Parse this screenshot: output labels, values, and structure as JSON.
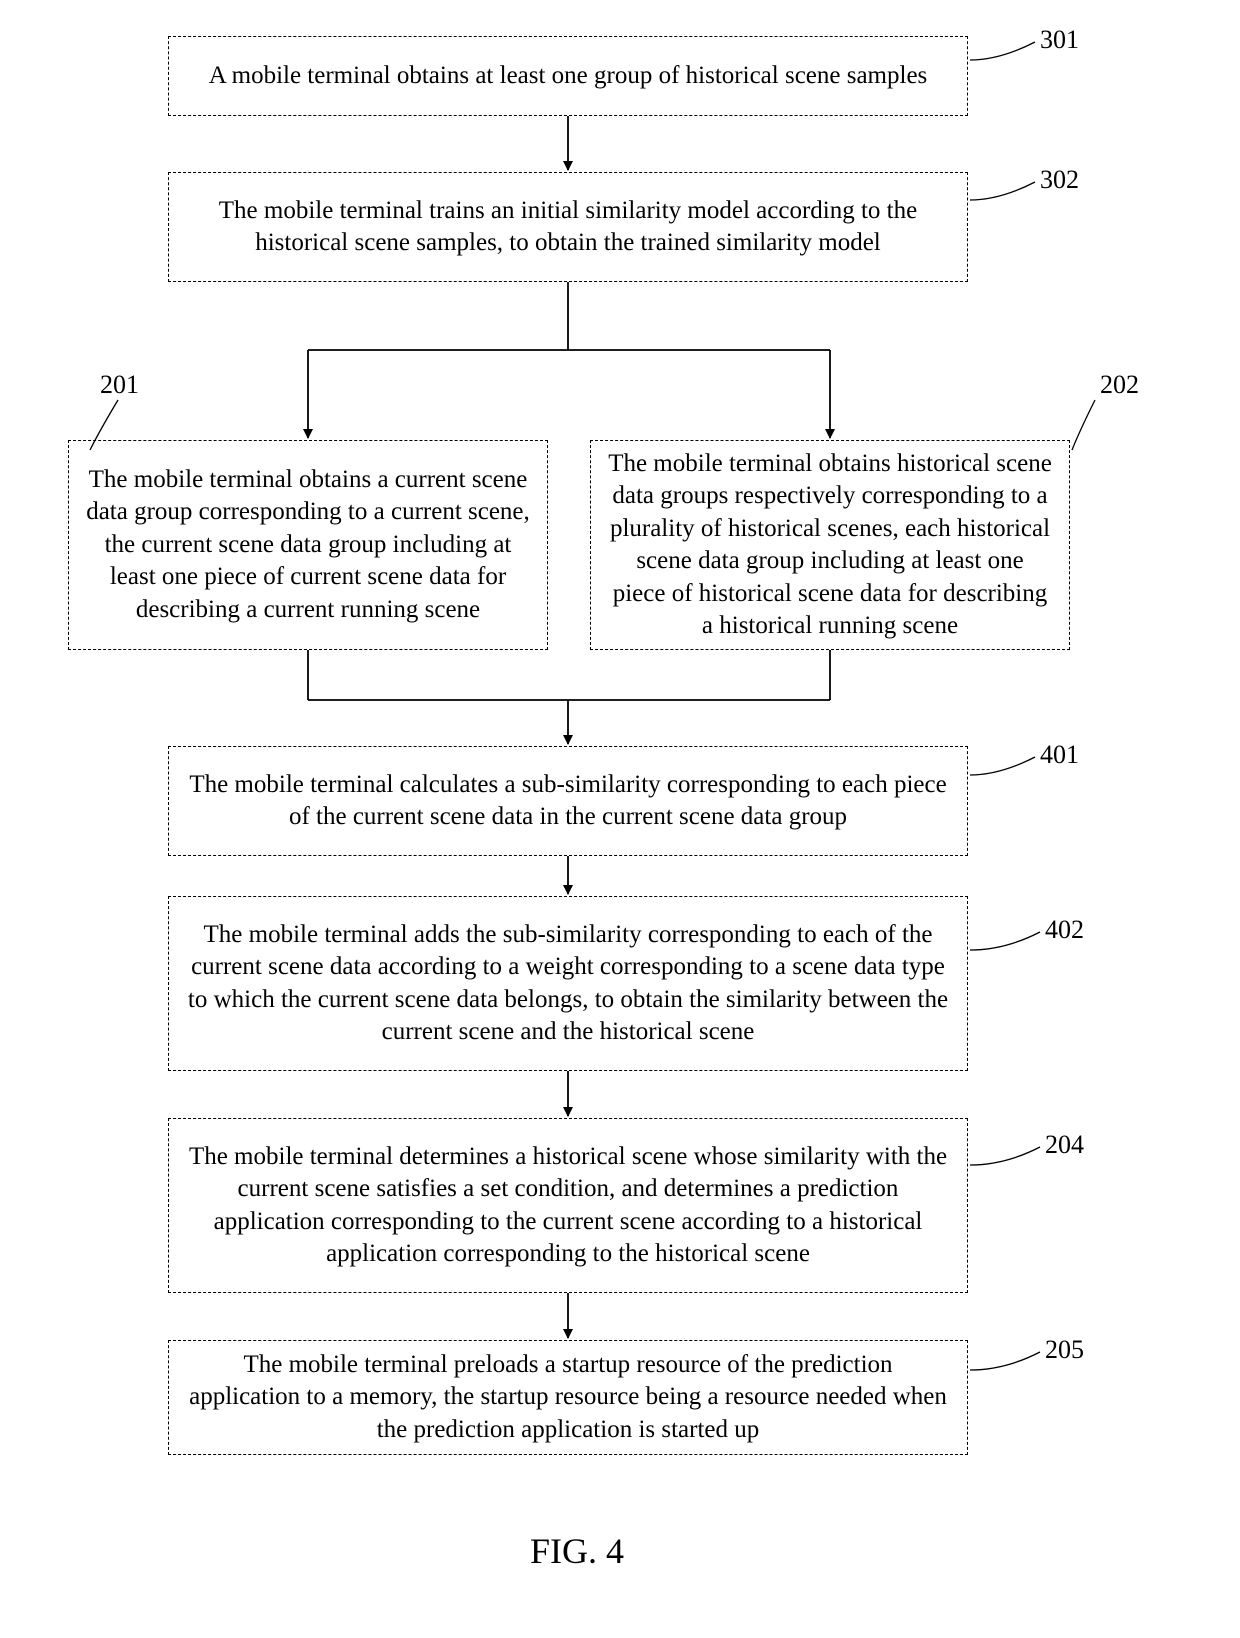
{
  "chart_data": {
    "type": "flowchart",
    "title": "FIG. 4",
    "nodes": [
      {
        "id": "301",
        "text": "A mobile terminal obtains at least one group of historical scene samples"
      },
      {
        "id": "302",
        "text": "The mobile terminal trains an initial similarity model according to the historical scene samples, to obtain the trained similarity model"
      },
      {
        "id": "201",
        "text": "The mobile terminal obtains a current scene data group corresponding to a current scene, the current scene data group including at least one piece of current scene data for describing a current running scene"
      },
      {
        "id": "202",
        "text": "The mobile terminal obtains historical scene data groups respectively corresponding to a plurality of historical scenes, each historical scene data group including at least one piece of historical scene data for describing a historical running scene"
      },
      {
        "id": "401",
        "text": "The mobile terminal calculates a sub-similarity corresponding to each piece of the current scene data in the current scene data group"
      },
      {
        "id": "402",
        "text": "The mobile terminal adds the sub-similarity corresponding to each of the current scene data according to a weight corresponding to a scene data type to which the current scene data belongs, to obtain the similarity between the current scene and the historical scene"
      },
      {
        "id": "204",
        "text": "The mobile terminal determines a historical scene whose similarity with the current scene satisfies a set condition, and determines a prediction application corresponding to the current scene according to a historical application corresponding to the historical scene"
      },
      {
        "id": "205",
        "text": "The mobile terminal preloads a startup resource of the prediction application to a memory, the startup resource being a resource needed when the prediction application is started up"
      }
    ],
    "edges": [
      {
        "from": "301",
        "to": "302"
      },
      {
        "from": "302",
        "to": "201"
      },
      {
        "from": "302",
        "to": "202"
      },
      {
        "from": "201",
        "to": "401"
      },
      {
        "from": "202",
        "to": "401"
      },
      {
        "from": "401",
        "to": "402"
      },
      {
        "from": "402",
        "to": "204"
      },
      {
        "from": "204",
        "to": "205"
      }
    ]
  },
  "labels": {
    "n301": "301",
    "n302": "302",
    "n201": "201",
    "n202": "202",
    "n401": "401",
    "n402": "402",
    "n204": "204",
    "n205": "205"
  },
  "caption": "FIG. 4"
}
